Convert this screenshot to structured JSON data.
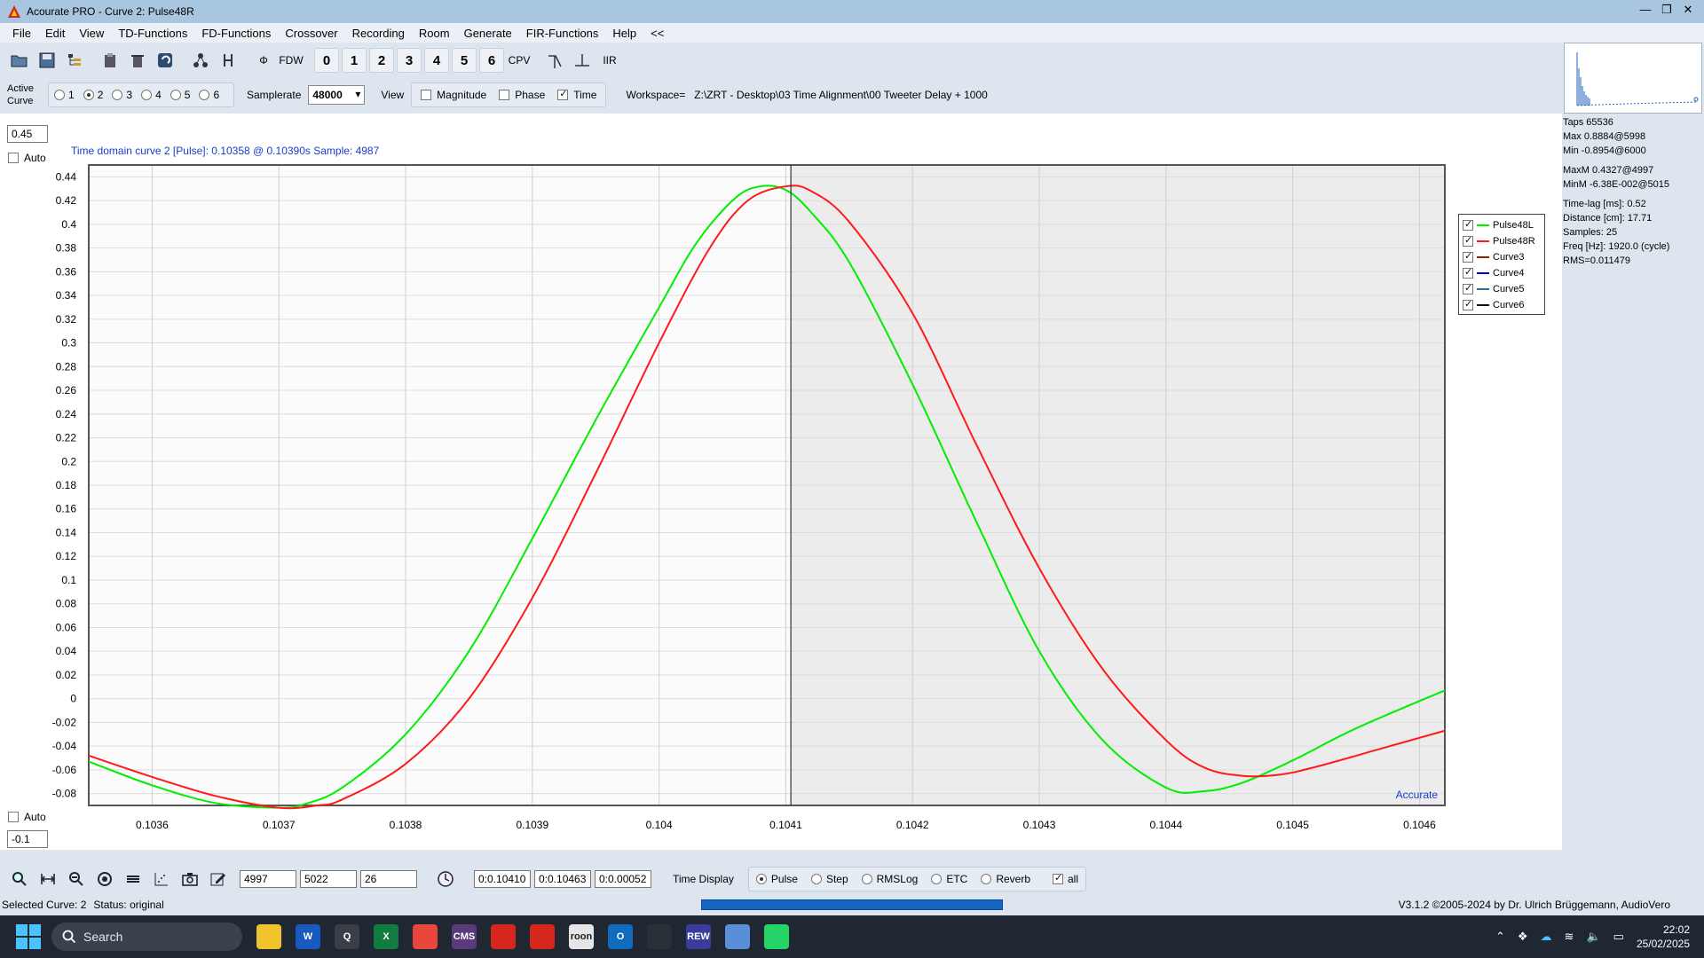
{
  "window": {
    "title": "Acourate PRO - Curve 2: Pulse48R",
    "controls": [
      "—",
      "❐",
      "✕"
    ]
  },
  "menu": [
    "File",
    "Edit",
    "View",
    "TD-Functions",
    "FD-Functions",
    "Crossover",
    "Recording",
    "Room",
    "Generate",
    "FIR-Functions",
    "Help",
    "<<"
  ],
  "toolbar": {
    "phi_label": "Φ",
    "fdw_label": "FDW",
    "curve_buttons": [
      "0",
      "1",
      "2",
      "3",
      "4",
      "5",
      "6"
    ],
    "cpv_label": "CPV",
    "iir_label": "IIR"
  },
  "active_curve": {
    "label_line1": "Active",
    "label_line2": "Curve",
    "options": [
      "1",
      "2",
      "3",
      "4",
      "5",
      "6"
    ],
    "selected": "2"
  },
  "samplerate": {
    "label": "Samplerate",
    "value": "48000"
  },
  "view": {
    "label": "View",
    "magnitude": "Magnitude",
    "phase": "Phase",
    "time": "Time"
  },
  "workspace": "Workspace=   Z:\\ZRT - Desktop\\03 Time Alignment\\00 Tweeter Delay + 1000",
  "left_controls": {
    "top_value": "0.45",
    "auto_label": "Auto",
    "bottom_value": "-0.1"
  },
  "stats": {
    "taps": "Taps 65536",
    "max": "Max 0.8884@5998",
    "min": "Min -0.8954@6000",
    "maxm": "MaxM 0.4327@4997",
    "minm": "MinM -6.38E-002@5015",
    "timelag": "Time-lag [ms]: 0.52",
    "distance": "Distance [cm]: 17.71",
    "samples": "Samples:  25",
    "freq": "Freq [Hz]: 1920.0 (cycle)",
    "rms": "RMS=0.011479"
  },
  "chart_data": {
    "type": "line",
    "title": "Time domain curve 2 [Pulse]:  0.10358 @ 0.10390s   Sample: 4987",
    "watermark": "Accurate",
    "xlim": [
      0.10355,
      0.10462
    ],
    "ylim": [
      -0.1,
      0.45
    ],
    "x_ticks": [
      "0.1036",
      "0.1037",
      "0.1038",
      "0.1039",
      "0.104",
      "0.1041",
      "0.1042",
      "0.1043",
      "0.1044",
      "0.1045",
      "0.1046"
    ],
    "y_ticks": [
      "0.44",
      "0.42",
      "0.4",
      "0.38",
      "0.36",
      "0.34",
      "0.32",
      "0.3",
      "0.28",
      "0.26",
      "0.24",
      "0.22",
      "0.2",
      "0.18",
      "0.16",
      "0.14",
      "0.12",
      "0.1",
      "0.08",
      "0.06",
      "0.04",
      "0.02",
      "0",
      "-0.02",
      "-0.04",
      "-0.06",
      "-0.08"
    ],
    "cursor_x": 0.104104,
    "series": [
      {
        "name": "Pulse48L",
        "color": "#00ee00",
        "points": [
          [
            0.10355,
            -0.053
          ],
          [
            0.1036,
            -0.073
          ],
          [
            0.10365,
            -0.088
          ],
          [
            0.1037,
            -0.092
          ],
          [
            0.10372,
            -0.089
          ],
          [
            0.10375,
            -0.075
          ],
          [
            0.1038,
            -0.03
          ],
          [
            0.10385,
            0.04
          ],
          [
            0.1039,
            0.135
          ],
          [
            0.10395,
            0.235
          ],
          [
            0.104,
            0.33
          ],
          [
            0.10403,
            0.385
          ],
          [
            0.10406,
            0.422
          ],
          [
            0.10408,
            0.432
          ],
          [
            0.1041,
            0.429
          ],
          [
            0.10412,
            0.41
          ],
          [
            0.10415,
            0.368
          ],
          [
            0.1042,
            0.265
          ],
          [
            0.10425,
            0.15
          ],
          [
            0.1043,
            0.04
          ],
          [
            0.10435,
            -0.035
          ],
          [
            0.1044,
            -0.075
          ],
          [
            0.10443,
            -0.078
          ],
          [
            0.10446,
            -0.071
          ],
          [
            0.1045,
            -0.052
          ],
          [
            0.10455,
            -0.025
          ],
          [
            0.10462,
            0.007
          ]
        ]
      },
      {
        "name": "Pulse48R",
        "color": "#ff1a1a",
        "points": [
          [
            0.10355,
            -0.048
          ],
          [
            0.1036,
            -0.066
          ],
          [
            0.10365,
            -0.082
          ],
          [
            0.1037,
            -0.092
          ],
          [
            0.10373,
            -0.09
          ],
          [
            0.10375,
            -0.085
          ],
          [
            0.1038,
            -0.055
          ],
          [
            0.10385,
            0.0
          ],
          [
            0.1039,
            0.085
          ],
          [
            0.10395,
            0.19
          ],
          [
            0.104,
            0.3
          ],
          [
            0.10404,
            0.38
          ],
          [
            0.10407,
            0.42
          ],
          [
            0.1041,
            0.432
          ],
          [
            0.10412,
            0.428
          ],
          [
            0.10415,
            0.402
          ],
          [
            0.1042,
            0.325
          ],
          [
            0.10425,
            0.215
          ],
          [
            0.1043,
            0.11
          ],
          [
            0.10435,
            0.025
          ],
          [
            0.1044,
            -0.035
          ],
          [
            0.10443,
            -0.058
          ],
          [
            0.10446,
            -0.065
          ],
          [
            0.10449,
            -0.064
          ],
          [
            0.10452,
            -0.057
          ],
          [
            0.10457,
            -0.042
          ],
          [
            0.10462,
            -0.027
          ]
        ]
      }
    ]
  },
  "legend": [
    {
      "name": "Pulse48L",
      "color": "#00ee00"
    },
    {
      "name": "Pulse48R",
      "color": "#ff1a1a"
    },
    {
      "name": "Curve3",
      "color": "#8b2500"
    },
    {
      "name": "Curve4",
      "color": "#0000cc"
    },
    {
      "name": "Curve5",
      "color": "#2f6f8f"
    },
    {
      "name": "Curve6",
      "color": "#111111"
    }
  ],
  "bottom": {
    "field1": "4997",
    "field2": "5022",
    "field3": "26",
    "time1": "0:0.10410",
    "time2": "0:0.10463",
    "time3": "0:0.00052",
    "time_display_label": "Time Display",
    "modes": [
      "Pulse",
      "Step",
      "RMSLog",
      "ETC",
      "Reverb"
    ],
    "selected_mode": "Pulse",
    "all_label": "all"
  },
  "statusbar": {
    "selected": "Selected Curve: 2",
    "status": "Status: original",
    "version": "V3.1.2 ©2005-2024 by Dr. Ulrich Brüggemann, AudioVero"
  },
  "taskbar": {
    "search_placeholder": "Search",
    "time": "22:02",
    "date": "25/02/2025",
    "apps": [
      {
        "name": "file-explorer",
        "label": "",
        "color": "#f2c12e"
      },
      {
        "name": "word",
        "label": "W",
        "color": "#185abd"
      },
      {
        "name": "search-app",
        "label": "Q",
        "color": "#3a3f47"
      },
      {
        "name": "excel",
        "label": "X",
        "color": "#107c41"
      },
      {
        "name": "chrome",
        "label": "",
        "color": "#e8453c"
      },
      {
        "name": "cms",
        "label": "CMS",
        "color": "#5a3a7a"
      },
      {
        "name": "acrobat",
        "label": "",
        "color": "#d7261e"
      },
      {
        "name": "acourate",
        "label": "",
        "color": "#d7261e"
      },
      {
        "name": "roon",
        "label": "roon",
        "color": "#e6e6e6"
      },
      {
        "name": "outlook",
        "label": "O",
        "color": "#0f6cbd"
      },
      {
        "name": "app-grid",
        "label": "",
        "color": "#2a3038"
      },
      {
        "name": "rew",
        "label": "REW",
        "color": "#3b3b9b"
      },
      {
        "name": "app-blue",
        "label": "",
        "color": "#5a8fd8"
      },
      {
        "name": "whatsapp",
        "label": "",
        "color": "#25d366"
      }
    ]
  }
}
